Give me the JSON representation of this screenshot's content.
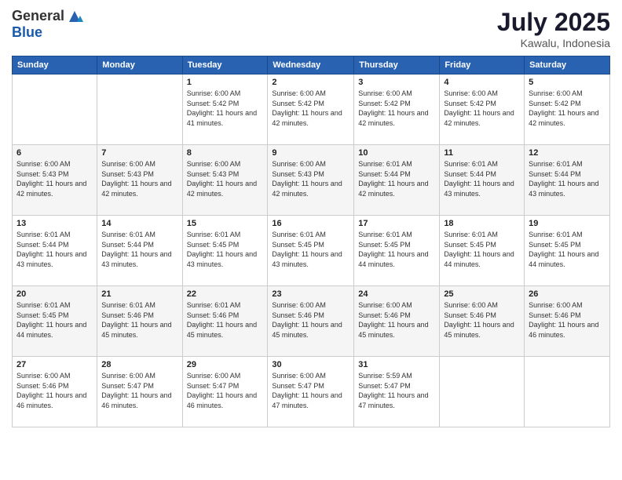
{
  "header": {
    "logo_general": "General",
    "logo_blue": "Blue",
    "month": "July 2025",
    "location": "Kawalu, Indonesia"
  },
  "weekdays": [
    "Sunday",
    "Monday",
    "Tuesday",
    "Wednesday",
    "Thursday",
    "Friday",
    "Saturday"
  ],
  "weeks": [
    [
      {
        "day": "",
        "info": ""
      },
      {
        "day": "",
        "info": ""
      },
      {
        "day": "1",
        "sunrise": "Sunrise: 6:00 AM",
        "sunset": "Sunset: 5:42 PM",
        "daylight": "Daylight: 11 hours and 41 minutes."
      },
      {
        "day": "2",
        "sunrise": "Sunrise: 6:00 AM",
        "sunset": "Sunset: 5:42 PM",
        "daylight": "Daylight: 11 hours and 42 minutes."
      },
      {
        "day": "3",
        "sunrise": "Sunrise: 6:00 AM",
        "sunset": "Sunset: 5:42 PM",
        "daylight": "Daylight: 11 hours and 42 minutes."
      },
      {
        "day": "4",
        "sunrise": "Sunrise: 6:00 AM",
        "sunset": "Sunset: 5:42 PM",
        "daylight": "Daylight: 11 hours and 42 minutes."
      },
      {
        "day": "5",
        "sunrise": "Sunrise: 6:00 AM",
        "sunset": "Sunset: 5:42 PM",
        "daylight": "Daylight: 11 hours and 42 minutes."
      }
    ],
    [
      {
        "day": "6",
        "sunrise": "Sunrise: 6:00 AM",
        "sunset": "Sunset: 5:43 PM",
        "daylight": "Daylight: 11 hours and 42 minutes."
      },
      {
        "day": "7",
        "sunrise": "Sunrise: 6:00 AM",
        "sunset": "Sunset: 5:43 PM",
        "daylight": "Daylight: 11 hours and 42 minutes."
      },
      {
        "day": "8",
        "sunrise": "Sunrise: 6:00 AM",
        "sunset": "Sunset: 5:43 PM",
        "daylight": "Daylight: 11 hours and 42 minutes."
      },
      {
        "day": "9",
        "sunrise": "Sunrise: 6:00 AM",
        "sunset": "Sunset: 5:43 PM",
        "daylight": "Daylight: 11 hours and 42 minutes."
      },
      {
        "day": "10",
        "sunrise": "Sunrise: 6:01 AM",
        "sunset": "Sunset: 5:44 PM",
        "daylight": "Daylight: 11 hours and 42 minutes."
      },
      {
        "day": "11",
        "sunrise": "Sunrise: 6:01 AM",
        "sunset": "Sunset: 5:44 PM",
        "daylight": "Daylight: 11 hours and 43 minutes."
      },
      {
        "day": "12",
        "sunrise": "Sunrise: 6:01 AM",
        "sunset": "Sunset: 5:44 PM",
        "daylight": "Daylight: 11 hours and 43 minutes."
      }
    ],
    [
      {
        "day": "13",
        "sunrise": "Sunrise: 6:01 AM",
        "sunset": "Sunset: 5:44 PM",
        "daylight": "Daylight: 11 hours and 43 minutes."
      },
      {
        "day": "14",
        "sunrise": "Sunrise: 6:01 AM",
        "sunset": "Sunset: 5:44 PM",
        "daylight": "Daylight: 11 hours and 43 minutes."
      },
      {
        "day": "15",
        "sunrise": "Sunrise: 6:01 AM",
        "sunset": "Sunset: 5:45 PM",
        "daylight": "Daylight: 11 hours and 43 minutes."
      },
      {
        "day": "16",
        "sunrise": "Sunrise: 6:01 AM",
        "sunset": "Sunset: 5:45 PM",
        "daylight": "Daylight: 11 hours and 43 minutes."
      },
      {
        "day": "17",
        "sunrise": "Sunrise: 6:01 AM",
        "sunset": "Sunset: 5:45 PM",
        "daylight": "Daylight: 11 hours and 44 minutes."
      },
      {
        "day": "18",
        "sunrise": "Sunrise: 6:01 AM",
        "sunset": "Sunset: 5:45 PM",
        "daylight": "Daylight: 11 hours and 44 minutes."
      },
      {
        "day": "19",
        "sunrise": "Sunrise: 6:01 AM",
        "sunset": "Sunset: 5:45 PM",
        "daylight": "Daylight: 11 hours and 44 minutes."
      }
    ],
    [
      {
        "day": "20",
        "sunrise": "Sunrise: 6:01 AM",
        "sunset": "Sunset: 5:45 PM",
        "daylight": "Daylight: 11 hours and 44 minutes."
      },
      {
        "day": "21",
        "sunrise": "Sunrise: 6:01 AM",
        "sunset": "Sunset: 5:46 PM",
        "daylight": "Daylight: 11 hours and 45 minutes."
      },
      {
        "day": "22",
        "sunrise": "Sunrise: 6:01 AM",
        "sunset": "Sunset: 5:46 PM",
        "daylight": "Daylight: 11 hours and 45 minutes."
      },
      {
        "day": "23",
        "sunrise": "Sunrise: 6:00 AM",
        "sunset": "Sunset: 5:46 PM",
        "daylight": "Daylight: 11 hours and 45 minutes."
      },
      {
        "day": "24",
        "sunrise": "Sunrise: 6:00 AM",
        "sunset": "Sunset: 5:46 PM",
        "daylight": "Daylight: 11 hours and 45 minutes."
      },
      {
        "day": "25",
        "sunrise": "Sunrise: 6:00 AM",
        "sunset": "Sunset: 5:46 PM",
        "daylight": "Daylight: 11 hours and 45 minutes."
      },
      {
        "day": "26",
        "sunrise": "Sunrise: 6:00 AM",
        "sunset": "Sunset: 5:46 PM",
        "daylight": "Daylight: 11 hours and 46 minutes."
      }
    ],
    [
      {
        "day": "27",
        "sunrise": "Sunrise: 6:00 AM",
        "sunset": "Sunset: 5:46 PM",
        "daylight": "Daylight: 11 hours and 46 minutes."
      },
      {
        "day": "28",
        "sunrise": "Sunrise: 6:00 AM",
        "sunset": "Sunset: 5:47 PM",
        "daylight": "Daylight: 11 hours and 46 minutes."
      },
      {
        "day": "29",
        "sunrise": "Sunrise: 6:00 AM",
        "sunset": "Sunset: 5:47 PM",
        "daylight": "Daylight: 11 hours and 46 minutes."
      },
      {
        "day": "30",
        "sunrise": "Sunrise: 6:00 AM",
        "sunset": "Sunset: 5:47 PM",
        "daylight": "Daylight: 11 hours and 47 minutes."
      },
      {
        "day": "31",
        "sunrise": "Sunrise: 5:59 AM",
        "sunset": "Sunset: 5:47 PM",
        "daylight": "Daylight: 11 hours and 47 minutes."
      },
      {
        "day": "",
        "info": ""
      },
      {
        "day": "",
        "info": ""
      }
    ]
  ]
}
